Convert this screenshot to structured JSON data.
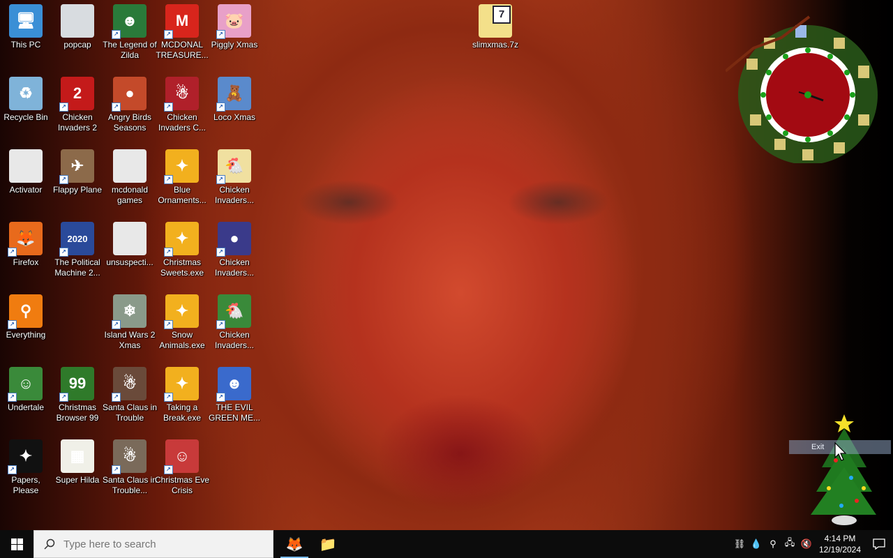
{
  "desktop": {
    "columns": [
      [
        {
          "name": "this-pc",
          "label": "This PC",
          "glyph": "🖥",
          "bg": "#3a8fd6",
          "shortcut": false
        },
        {
          "name": "recycle-bin",
          "label": "Recycle Bin",
          "glyph": "♻",
          "bg": "#7fb3d9",
          "shortcut": false
        },
        {
          "name": "activator",
          "label": "Activator",
          "glyph": "",
          "bg": "#e8e8e8",
          "shortcut": false
        },
        {
          "name": "firefox",
          "label": "Firefox",
          "glyph": "🦊",
          "bg": "#e86a1c",
          "shortcut": true
        },
        {
          "name": "everything",
          "label": "Everything",
          "glyph": "⚲",
          "bg": "#f07c10",
          "shortcut": true
        },
        {
          "name": "undertale",
          "label": "Undertale",
          "glyph": "☺",
          "bg": "#3a8a3a",
          "shortcut": true
        },
        {
          "name": "papers-please",
          "label": "Papers, Please",
          "glyph": "✦",
          "bg": "#111111",
          "shortcut": true
        }
      ],
      [
        {
          "name": "popcap",
          "label": "popcap",
          "glyph": "",
          "bg": "#d8dce0",
          "shortcut": false
        },
        {
          "name": "chicken-invaders-2",
          "label": "Chicken Invaders 2",
          "glyph": "2",
          "bg": "#c41a1a",
          "shortcut": true
        },
        {
          "name": "flappy-plane",
          "label": "Flappy Plane",
          "glyph": "✈",
          "bg": "#8c6a4a",
          "shortcut": true
        },
        {
          "name": "political-machine",
          "label": "The Political Machine 2...",
          "glyph": "2020",
          "bg": "#2a4a9a",
          "shortcut": true
        },
        null,
        {
          "name": "christmas-browser-99",
          "label": "Christmas Browser 99",
          "glyph": "99",
          "bg": "#2f7a2a",
          "shortcut": true
        },
        {
          "name": "super-hilda",
          "label": "Super Hilda",
          "glyph": "▦",
          "bg": "#f0f0e8",
          "shortcut": false
        }
      ],
      [
        {
          "name": "legend-of-zilda",
          "label": "The Legend of Zilda",
          "glyph": "☻",
          "bg": "#2a7a3a",
          "shortcut": true
        },
        {
          "name": "angry-birds-seasons",
          "label": "Angry Birds Seasons",
          "glyph": "●",
          "bg": "#c44a2a",
          "shortcut": true
        },
        {
          "name": "mcdonald-games",
          "label": "mcdonald games",
          "glyph": "",
          "bg": "#e8e8e8",
          "shortcut": false
        },
        {
          "name": "unsuspecting",
          "label": "unsuspecti...",
          "glyph": "",
          "bg": "#e8e8e8",
          "shortcut": false
        },
        {
          "name": "island-wars-2-xmas",
          "label": "Island Wars 2 Xmas",
          "glyph": "❄",
          "bg": "#8a9a8a",
          "shortcut": true
        },
        {
          "name": "santa-claus-trouble",
          "label": "Santa Claus in Trouble",
          "glyph": "☃",
          "bg": "#6a4a3a",
          "shortcut": true
        },
        {
          "name": "santa-claus-trouble-2",
          "label": "Santa Claus in Trouble...",
          "glyph": "☃",
          "bg": "#7a6a5a",
          "shortcut": true
        }
      ],
      [
        {
          "name": "mcdonalds-treasure",
          "label": "MCDONAL TREASURE...",
          "glyph": "M",
          "bg": "#d8251c",
          "shortcut": true
        },
        {
          "name": "chicken-invaders-c",
          "label": "Chicken Invaders C...",
          "glyph": "☃",
          "bg": "#b0202a",
          "shortcut": true
        },
        {
          "name": "blue-ornaments",
          "label": "Blue Ornaments...",
          "glyph": "✦",
          "bg": "#f2b01e",
          "shortcut": true
        },
        {
          "name": "christmas-sweets",
          "label": "Christmas Sweets.exe",
          "glyph": "✦",
          "bg": "#f2b01e",
          "shortcut": true
        },
        {
          "name": "snow-animals",
          "label": "Snow Animals.exe",
          "glyph": "✦",
          "bg": "#f2b01e",
          "shortcut": true
        },
        {
          "name": "taking-a-break",
          "label": "Taking a Break.exe",
          "glyph": "✦",
          "bg": "#f2b01e",
          "shortcut": true
        },
        {
          "name": "christmas-eve-crisis",
          "label": "Christmas Eve Crisis",
          "glyph": "☺",
          "bg": "#c83a3a",
          "shortcut": true
        }
      ],
      [
        {
          "name": "piggly-xmas",
          "label": "Piggly Xmas",
          "glyph": "🐷",
          "bg": "#e8a0c8",
          "shortcut": true
        },
        {
          "name": "loco-xmas",
          "label": "Loco Xmas",
          "glyph": "🧸",
          "bg": "#5a8acc",
          "shortcut": true
        },
        {
          "name": "chicken-invaders-a",
          "label": "Chicken Invaders...",
          "glyph": "🐔",
          "bg": "#f0e0a0",
          "shortcut": true
        },
        {
          "name": "chicken-invaders-b",
          "label": "Chicken Invaders...",
          "glyph": "●",
          "bg": "#3a3a8a",
          "shortcut": true
        },
        {
          "name": "chicken-invaders-d",
          "label": "Chicken Invaders...",
          "glyph": "🐔",
          "bg": "#3a8a3a",
          "shortcut": true
        },
        {
          "name": "evil-green-me",
          "label": "THE EVIL GREEN ME...",
          "glyph": "☻",
          "bg": "#3a6acc",
          "shortcut": true
        }
      ]
    ],
    "archive": {
      "label": "slimxmas.7z",
      "glyph": "7"
    }
  },
  "widgets": {
    "tree_menu_label": "Exit"
  },
  "taskbar": {
    "search_placeholder": "Type here to search",
    "apps": [
      {
        "name": "taskbar-firefox",
        "glyph": "🦊",
        "active": true
      },
      {
        "name": "taskbar-file-explorer",
        "glyph": "📁",
        "active": false
      }
    ],
    "tray": [
      {
        "name": "network-share-icon",
        "glyph": "⛓"
      },
      {
        "name": "drop-icon",
        "glyph": "💧"
      },
      {
        "name": "everything-tray-icon",
        "glyph": "⚲"
      },
      {
        "name": "network-icon",
        "glyph": "🖧"
      },
      {
        "name": "volume-muted-icon",
        "glyph": "🔇"
      }
    ],
    "time": "4:14 PM",
    "date": "12/19/2024"
  }
}
